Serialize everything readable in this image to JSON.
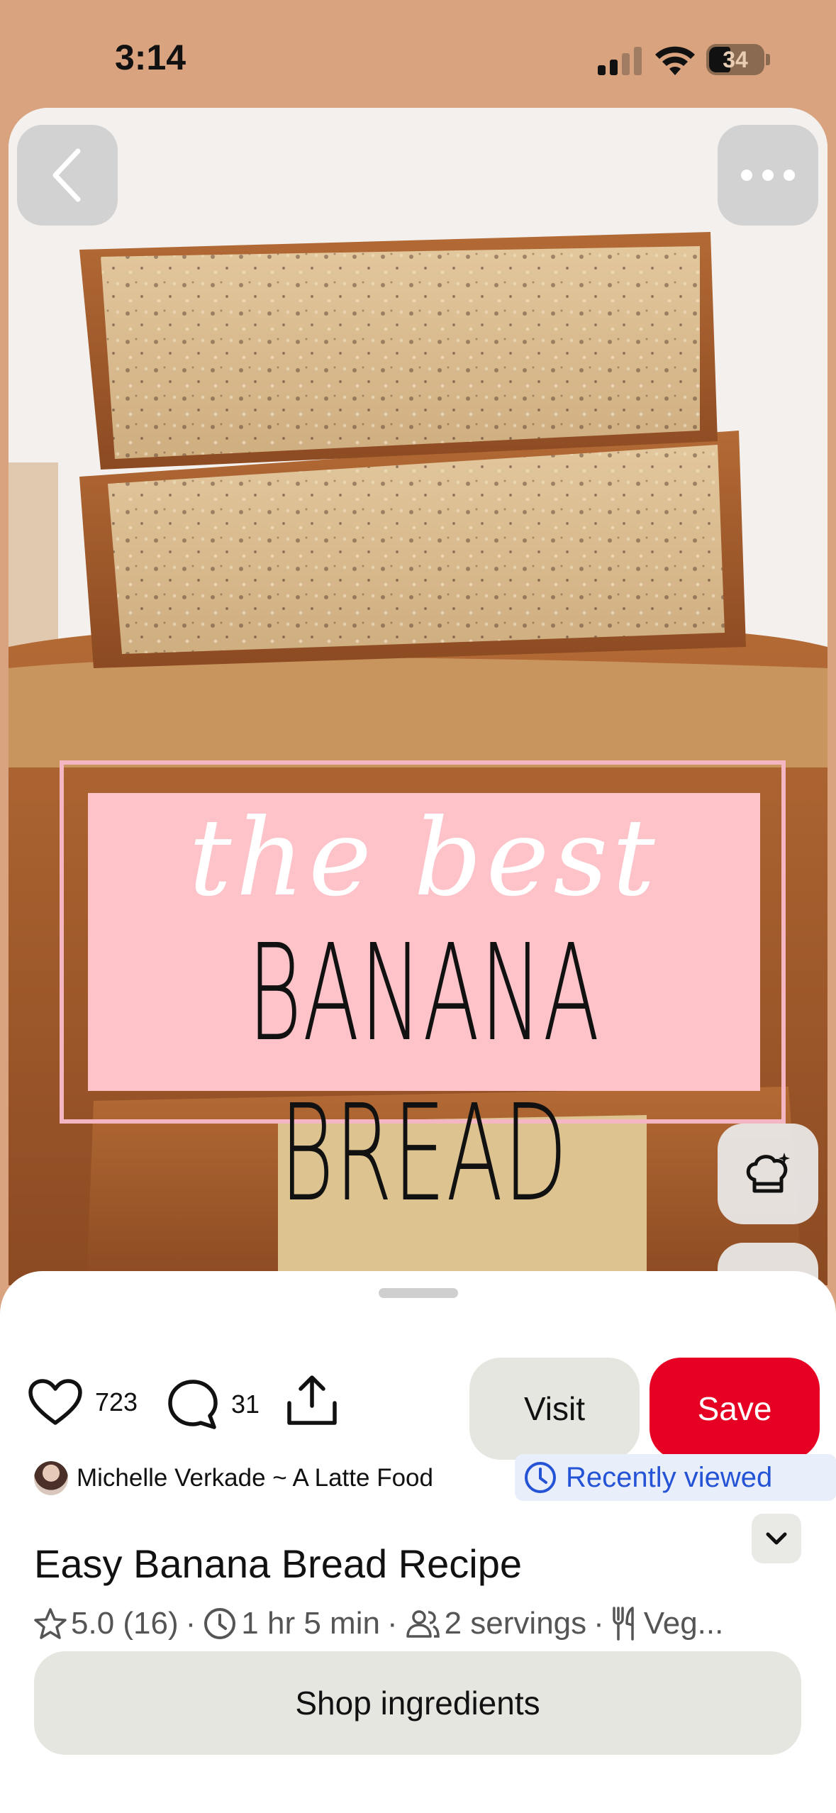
{
  "status_bar": {
    "time": "3:14",
    "battery": "34"
  },
  "pin": {
    "image_title_script": "the best",
    "image_title_main": "BANANA BREAD"
  },
  "actions": {
    "likes": "723",
    "comments": "31",
    "visit_label": "Visit",
    "save_label": "Save",
    "save_color": "#e60023"
  },
  "creator": {
    "name": "Michelle Verkade ~ A Latte Food",
    "badge": "Recently viewed",
    "badge_color": "#2453d6"
  },
  "recipe": {
    "title": "Easy Banana Bread Recipe",
    "rating": "5.0 (16)",
    "time": "1 hr 5 min",
    "servings": "2 servings",
    "diet": "Veg..."
  },
  "shop": {
    "label": "Shop ingredients"
  },
  "icons": [
    "back-icon",
    "more-icon",
    "chef-hat-icon",
    "heart-icon",
    "comment-icon",
    "share-icon",
    "clock-icon",
    "chevron-down-icon",
    "star-icon",
    "people-icon",
    "utensils-icon"
  ]
}
